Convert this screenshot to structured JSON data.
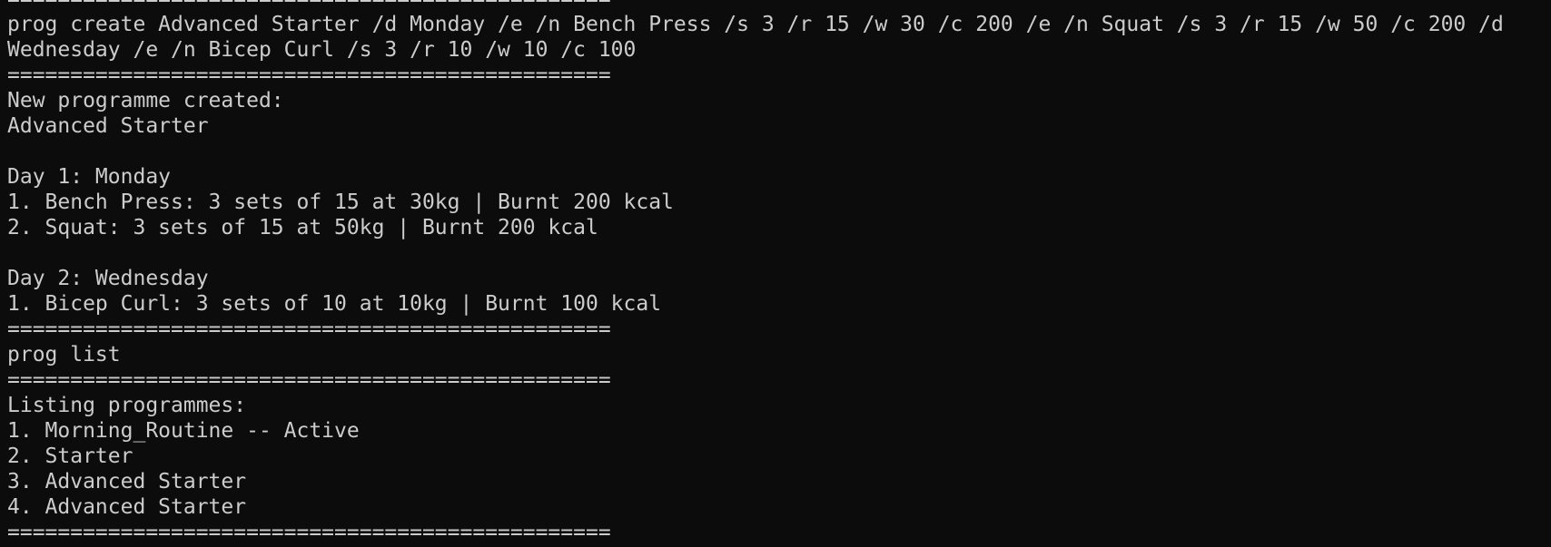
{
  "terminal": {
    "lines": [
      "================================================",
      "prog create Advanced Starter /d Monday /e /n Bench Press /s 3 /r 15 /w 30 /c 200 /e /n Squat /s 3 /r 15 /w 50 /c 200 /d",
      "Wednesday /e /n Bicep Curl /s 3 /r 10 /w 10 /c 100",
      "================================================",
      "New programme created:",
      "Advanced Starter",
      "",
      "Day 1: Monday",
      "1. Bench Press: 3 sets of 15 at 30kg | Burnt 200 kcal",
      "2. Squat: 3 sets of 15 at 50kg | Burnt 200 kcal",
      "",
      "Day 2: Wednesday",
      "1. Bicep Curl: 3 sets of 10 at 10kg | Burnt 100 kcal",
      "================================================",
      "prog list",
      "================================================",
      "Listing programmes:",
      "1. Morning_Routine -- Active",
      "2. Starter",
      "3. Advanced Starter",
      "4. Advanced Starter",
      "================================================"
    ]
  },
  "colors": {
    "background": "#0c0c0c",
    "foreground": "#cccccc"
  }
}
